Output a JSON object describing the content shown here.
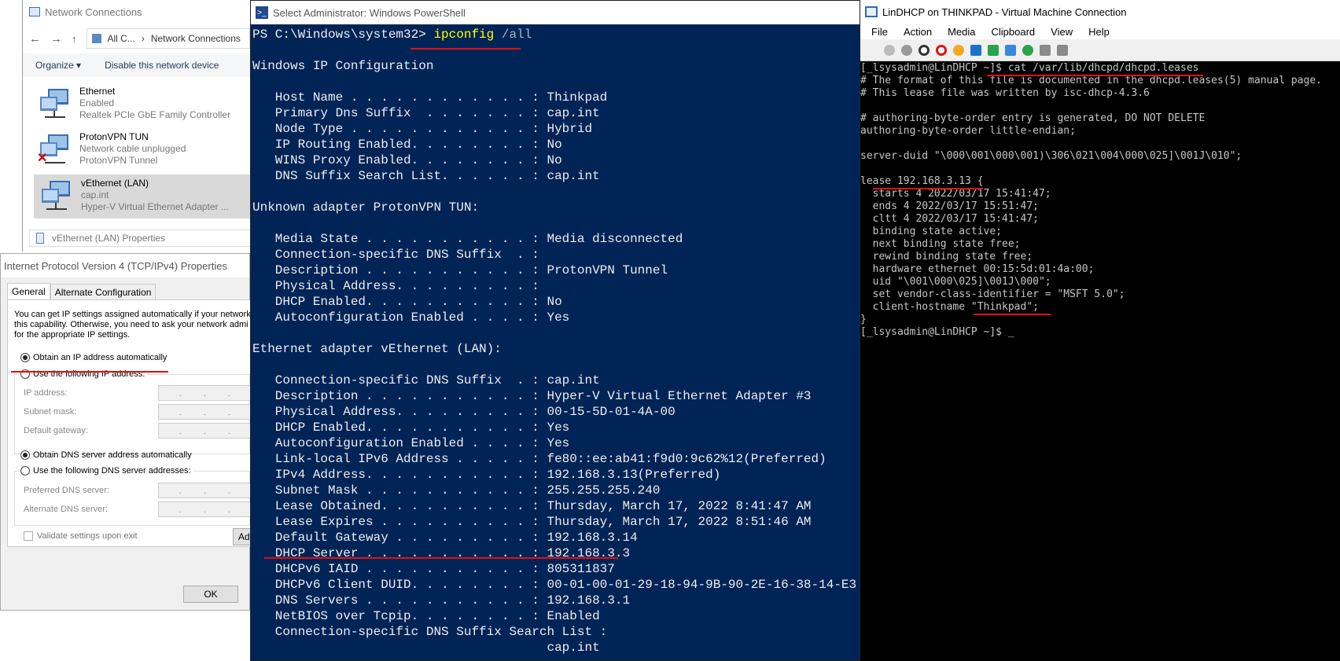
{
  "netconn": {
    "title": "Network Connections",
    "breadcrumb_1": "All C...",
    "breadcrumb_2": "Network Connections",
    "organize": "Organize ▾",
    "disable": "Disable this network device",
    "adapters": [
      {
        "name": "Ethernet",
        "status": "Enabled",
        "device": "Realtek PCIe GbE Family Controller"
      },
      {
        "name": "ProtonVPN TUN",
        "status": "Network cable unplugged",
        "device": "ProtonVPN Tunnel"
      },
      {
        "name": "vEthernet (LAN)",
        "status": "cap.int",
        "device": "Hyper-V Virtual Ethernet Adapter ..."
      }
    ],
    "properties_title": "vEthernet (LAN) Properties"
  },
  "ipv4": {
    "title": "Internet Protocol Version 4 (TCP/IPv4) Properties",
    "tab_general": "General",
    "tab_alternate": "Alternate Configuration",
    "intro": "You can get IP settings assigned automatically if your network\nthis capability. Otherwise, you need to ask your network admi\nfor the appropriate IP settings.",
    "obtain_ip": "Obtain an IP address automatically",
    "use_ip": "Use the following IP address:",
    "ip_address": "IP address:",
    "subnet_mask": "Subnet mask:",
    "default_gateway": "Default gateway:",
    "obtain_dns": "Obtain DNS server address automatically",
    "use_dns": "Use the following DNS server addresses:",
    "preferred_dns": "Preferred DNS server:",
    "alternate_dns": "Alternate DNS server:",
    "validate": "Validate settings upon exit",
    "advanced": "Adv",
    "ok": "OK",
    "ip_placeholder": ".       .       ."
  },
  "powershell": {
    "title": "Select Administrator: Windows PowerShell",
    "prompt": "PS C:\\Windows\\system32> ",
    "command": "ipconfig",
    "argument": " /all",
    "lines": [
      "",
      "Windows IP Configuration",
      "",
      "   Host Name . . . . . . . . . . . . : Thinkpad",
      "   Primary Dns Suffix  . . . . . . . : cap.int",
      "   Node Type . . . . . . . . . . . . : Hybrid",
      "   IP Routing Enabled. . . . . . . . : No",
      "   WINS Proxy Enabled. . . . . . . . : No",
      "   DNS Suffix Search List. . . . . . : cap.int",
      "",
      "Unknown adapter ProtonVPN TUN:",
      "",
      "   Media State . . . . . . . . . . . : Media disconnected",
      "   Connection-specific DNS Suffix  . :",
      "   Description . . . . . . . . . . . : ProtonVPN Tunnel",
      "   Physical Address. . . . . . . . . :",
      "   DHCP Enabled. . . . . . . . . . . : No",
      "   Autoconfiguration Enabled . . . . : Yes",
      "",
      "Ethernet adapter vEthernet (LAN):",
      "",
      "   Connection-specific DNS Suffix  . : cap.int",
      "   Description . . . . . . . . . . . : Hyper-V Virtual Ethernet Adapter #3",
      "   Physical Address. . . . . . . . . : 00-15-5D-01-4A-00",
      "   DHCP Enabled. . . . . . . . . . . : Yes",
      "   Autoconfiguration Enabled . . . . : Yes",
      "   Link-local IPv6 Address . . . . . : fe80::ee:ab41:f9d0:9c62%12(Preferred)",
      "   IPv4 Address. . . . . . . . . . . : 192.168.3.13(Preferred)",
      "   Subnet Mask . . . . . . . . . . . : 255.255.255.240",
      "   Lease Obtained. . . . . . . . . . : Thursday, March 17, 2022 8:41:47 AM",
      "   Lease Expires . . . . . . . . . . : Thursday, March 17, 2022 8:51:46 AM",
      "   Default Gateway . . . . . . . . . : 192.168.3.14",
      "   DHCP Server . . . . . . . . . . . : 192.168.3.3",
      "   DHCPv6 IAID . . . . . . . . . . . : 805311837",
      "   DHCPv6 Client DUID. . . . . . . . : 00-01-00-01-29-18-94-9B-90-2E-16-38-14-E3",
      "   DNS Servers . . . . . . . . . . . : 192.168.3.1",
      "   NetBIOS over Tcpip. . . . . . . . : Enabled",
      "   Connection-specific DNS Suffix Search List :",
      "                                       cap.int"
    ]
  },
  "vm": {
    "title": "LinDHCP on THINKPAD - Virtual Machine Connection",
    "menu": [
      "File",
      "Action",
      "Media",
      "Clipboard",
      "View",
      "Help"
    ],
    "lines": [
      "[_lsysadmin@LinDHCP ~]$ cat /var/lib/dhcpd/dhcpd.leases",
      "# The format of this file is documented in the dhcpd.leases(5) manual page.",
      "# This lease file was written by isc-dhcp-4.3.6",
      "",
      "# authoring-byte-order entry is generated, DO NOT DELETE",
      "authoring-byte-order little-endian;",
      "",
      "server-duid \"\\000\\001\\000\\001)\\306\\021\\004\\000\\025]\\001J\\010\";",
      "",
      "lease 192.168.3.13 {",
      "  starts 4 2022/03/17 15:41:47;",
      "  ends 4 2022/03/17 15:51:47;",
      "  cltt 4 2022/03/17 15:41:47;",
      "  binding state active;",
      "  next binding state free;",
      "  rewind binding state free;",
      "  hardware ethernet 00:15:5d:01:4a:00;",
      "  uid \"\\001\\000\\025]\\001J\\000\";",
      "  set vendor-class-identifier = \"MSFT 5.0\";",
      "  client-hostname \"Thinkpad\";",
      "}",
      "[_lsysadmin@LinDHCP ~]$ _"
    ]
  },
  "colors": {
    "ps_background": "#012456",
    "ps_command": "#ffff00",
    "annotation": "#e01010"
  }
}
